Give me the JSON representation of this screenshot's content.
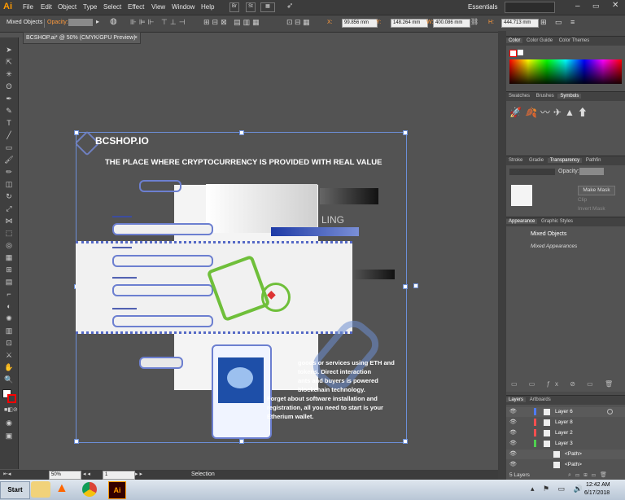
{
  "app": {
    "logo": "Ai"
  },
  "menu": [
    "File",
    "Edit",
    "Object",
    "Type",
    "Select",
    "Effect",
    "View",
    "Window",
    "Help"
  ],
  "workspace": "Essentials",
  "control_bar": {
    "selection_label": "Mixed Objects",
    "opacity_label": "Opacity:",
    "x_label": "X:",
    "x_value": "99.856 mm",
    "y_label": "Y:",
    "y_value": "148.264 mm",
    "w_label": "W:",
    "w_value": "400.086 mm",
    "h_label": "H:",
    "h_value": "444.713 mm"
  },
  "document_tab": "BCSHOP.ai* @ 50% (CMYK/GPU Preview)",
  "artwork": {
    "logo_text": "BCSHOP.IO",
    "headline": "THE PLACE WHERE CRYPTOCURRENCY IS PROVIDED WITH REAL VALUE",
    "ling": "LING",
    "body_text": [
      "goods or services using ETH and",
      "tokens. Direct interaction",
      "ants and buyers is powered",
      "blockchain technology.",
      "Forget about software installation and",
      "registration, all you need to start is your",
      "Etherium wallet."
    ]
  },
  "right_panels": {
    "color_tabs": [
      "Color",
      "Color Guide",
      "Color Themes"
    ],
    "swatch_tabs": [
      "Swatches",
      "Brushes",
      "Symbols"
    ],
    "transparency_tabs": [
      "Stroke",
      "Gradie",
      "Transparency",
      "Pathfin"
    ],
    "transparency": {
      "opacity_label": "Opacity:",
      "make_mask": "Make Mask",
      "clip": "Clip",
      "invert_mask": "Invert Mask"
    },
    "appearance_tabs": [
      "Appearance",
      "Graphic Styles"
    ],
    "appearance": {
      "title": "Mixed Objects",
      "subtitle": "Mixed Appearances"
    },
    "layers_tabs": [
      "Layers",
      "Artboards"
    ],
    "layers": [
      {
        "name": "Layer 6",
        "color": "#4f7bff"
      },
      {
        "name": "Layer 8",
        "color": "#ff4f4f"
      },
      {
        "name": "Layer 2",
        "color": "#ff4f4f"
      },
      {
        "name": "Layer 3",
        "color": "#4fd14f"
      },
      {
        "name": "<Path>",
        "color": "#4fd14f"
      },
      {
        "name": "<Path>",
        "color": "#4fd14f"
      }
    ],
    "layers_count": "5 Layers"
  },
  "status_bar": {
    "zoom": "50%",
    "artboard": "1",
    "tool": "Selection"
  },
  "taskbar": {
    "start": "Start",
    "time": "12:42 AM",
    "date": "6/17/2018"
  }
}
